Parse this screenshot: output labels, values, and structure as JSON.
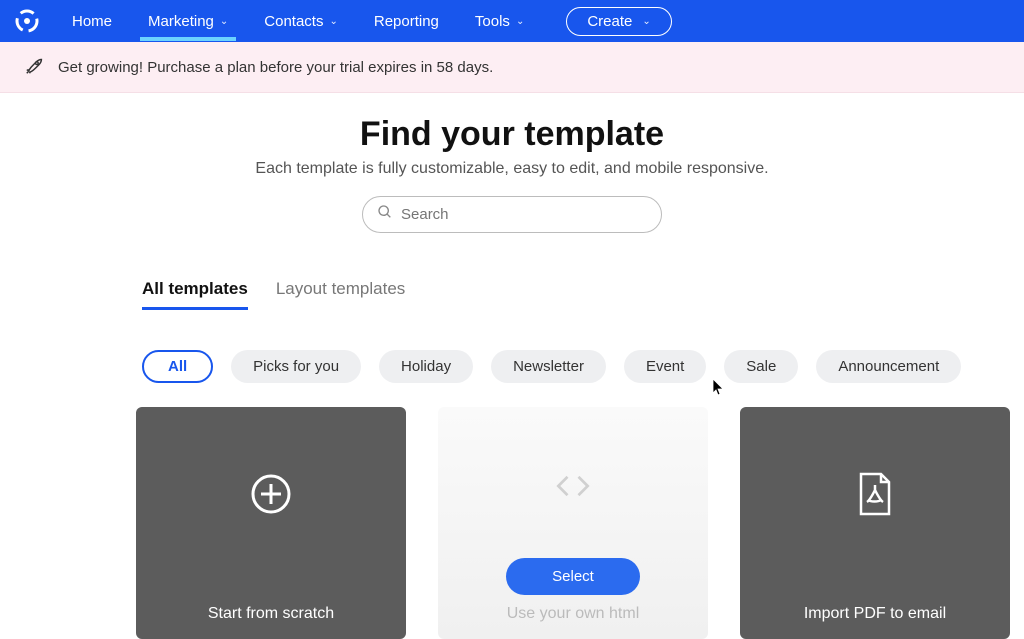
{
  "nav": {
    "items": [
      {
        "label": "Home"
      },
      {
        "label": "Marketing",
        "dropdown": true
      },
      {
        "label": "Contacts",
        "dropdown": true
      },
      {
        "label": "Reporting"
      },
      {
        "label": "Tools",
        "dropdown": true
      }
    ],
    "create_label": "Create"
  },
  "banner": {
    "text": "Get growing! Purchase a plan before your trial expires in 58 days."
  },
  "hero": {
    "title": "Find your template",
    "subtitle": "Each template is fully customizable, easy to edit, and mobile responsive."
  },
  "search": {
    "placeholder": "Search"
  },
  "tabs": [
    {
      "label": "All templates",
      "active": true
    },
    {
      "label": "Layout templates",
      "active": false
    }
  ],
  "filters": [
    {
      "label": "All",
      "active": true
    },
    {
      "label": "Picks for you"
    },
    {
      "label": "Holiday"
    },
    {
      "label": "Newsletter"
    },
    {
      "label": "Event"
    },
    {
      "label": "Sale"
    },
    {
      "label": "Announcement"
    }
  ],
  "cards": {
    "scratch_label": "Start from scratch",
    "html_label": "Use your own html",
    "select_label": "Select",
    "pdf_label": "Import PDF to email"
  }
}
